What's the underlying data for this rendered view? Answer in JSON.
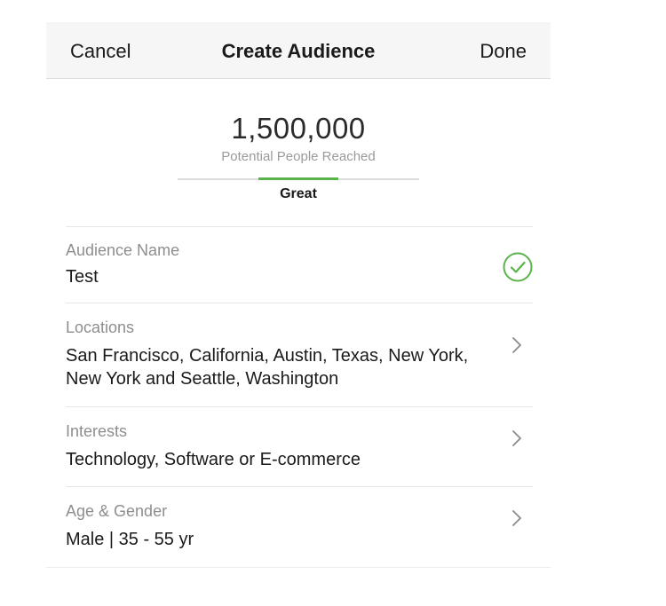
{
  "navbar": {
    "cancel_label": "Cancel",
    "title": "Create Audience",
    "done_label": "Done"
  },
  "reach": {
    "count": "1,500,000",
    "caption": "Potential People Reached",
    "rating": "Great",
    "meter_fill_fraction": 0.33
  },
  "rows": [
    {
      "label": "Audience Name",
      "value": "Test",
      "icon": "checkmark-circle-icon"
    },
    {
      "label": "Locations",
      "value": "San Francisco, California, Austin, Texas, New York, New York and Seattle, Washington",
      "icon": "chevron-right-icon"
    },
    {
      "label": "Interests",
      "value": "Technology, Software or E-commerce",
      "icon": "chevron-right-icon"
    },
    {
      "label": "Age & Gender",
      "value": "Male | 35 - 55 yr",
      "icon": "chevron-right-icon"
    }
  ],
  "colors": {
    "accent_green": "#5ab34a",
    "navbar_bg": "#f6f6f6",
    "label_gray": "#8e8e8e"
  }
}
